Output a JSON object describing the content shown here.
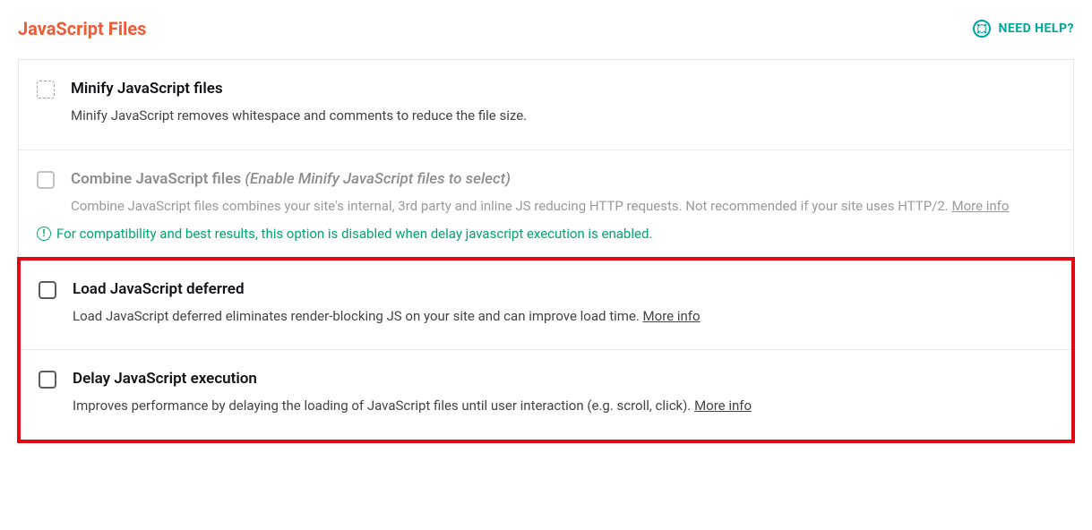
{
  "header": {
    "title": "JavaScript Files",
    "help_label": "NEED HELP?"
  },
  "options": {
    "minify": {
      "title": "Minify JavaScript files",
      "desc": "Minify JavaScript removes whitespace and comments to reduce the file size."
    },
    "combine": {
      "title": "Combine JavaScript files",
      "title_note": "(Enable Minify JavaScript files to select)",
      "desc": "Combine JavaScript files combines your site's internal, 3rd party and inline JS reducing HTTP requests. Not recommended if your site uses HTTP/2.",
      "more_info": "More info",
      "compat_note": "For compatibility and best results, this option is disabled when delay javascript execution is enabled."
    },
    "defer": {
      "title": "Load JavaScript deferred",
      "desc": "Load JavaScript deferred eliminates render-blocking JS on your site and can improve load time.",
      "more_info": "More info"
    },
    "delay": {
      "title": "Delay JavaScript execution",
      "desc": "Improves performance by delaying the loading of JavaScript files until user interaction (e.g. scroll, click).",
      "more_info": "More info"
    }
  }
}
